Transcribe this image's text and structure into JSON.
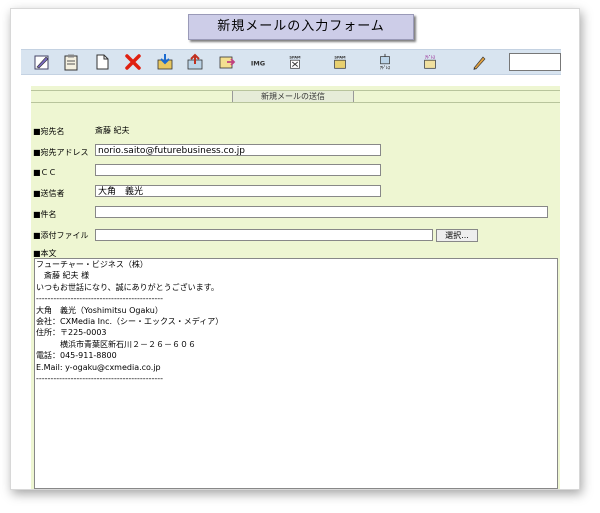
{
  "window_title": "新規メールの入力フォーム",
  "toolbar": {
    "icons": [
      {
        "name": "compose-icon"
      },
      {
        "name": "clipboard-icon"
      },
      {
        "name": "new-document-icon"
      },
      {
        "name": "delete-icon"
      },
      {
        "name": "import-icon"
      },
      {
        "name": "export-icon"
      },
      {
        "name": "forward-icon"
      },
      {
        "name": "img-icon",
        "text": "IMG"
      },
      {
        "name": "spam-delete-icon",
        "text": "SPAM"
      },
      {
        "name": "spam-icon",
        "text": "SPAM"
      },
      {
        "name": "address-icon",
        "text": "ｱﾄﾞﾚｽ"
      },
      {
        "name": "address-book-icon",
        "text": "ｱﾄﾞﾚｽ"
      },
      {
        "name": "pencil-icon"
      }
    ],
    "search_value": ""
  },
  "form": {
    "section_title": "新規メールの送信",
    "recipient_name_label": "■宛先名",
    "recipient_name": "斎藤 紀夫",
    "recipient_address_label": "■宛先アドレス",
    "recipient_address": "norio.saito@futurebusiness.co.jp",
    "cc_label": "■ＣＣ",
    "cc": "",
    "sender_label": "■送信者",
    "sender": "大角　義光",
    "subject_label": "■件名",
    "subject": "",
    "attachment_label": "■添付ファイル",
    "attachment": "",
    "browse_label": "選択...",
    "body_label": "■本文",
    "body_lines": [
      "フューチャー・ビジネス（株）",
      "　斎藤 紀夫 様",
      "",
      "いつもお世話になり、誠にありがとうございます。",
      "",
      "",
      "",
      "--------------------------------------------",
      "大角　義光（Yoshimitsu Ogaku）",
      "会社：CXMedia Inc.（シー・エックス・メディア）",
      "住所：〒225-0003",
      "　　　横浜市青葉区新石川２－２６－６０６",
      "電話：045-911-8800",
      "E.Mail: y-ogaku@cxmedia.co.jp",
      "--------------------------------------------"
    ]
  }
}
